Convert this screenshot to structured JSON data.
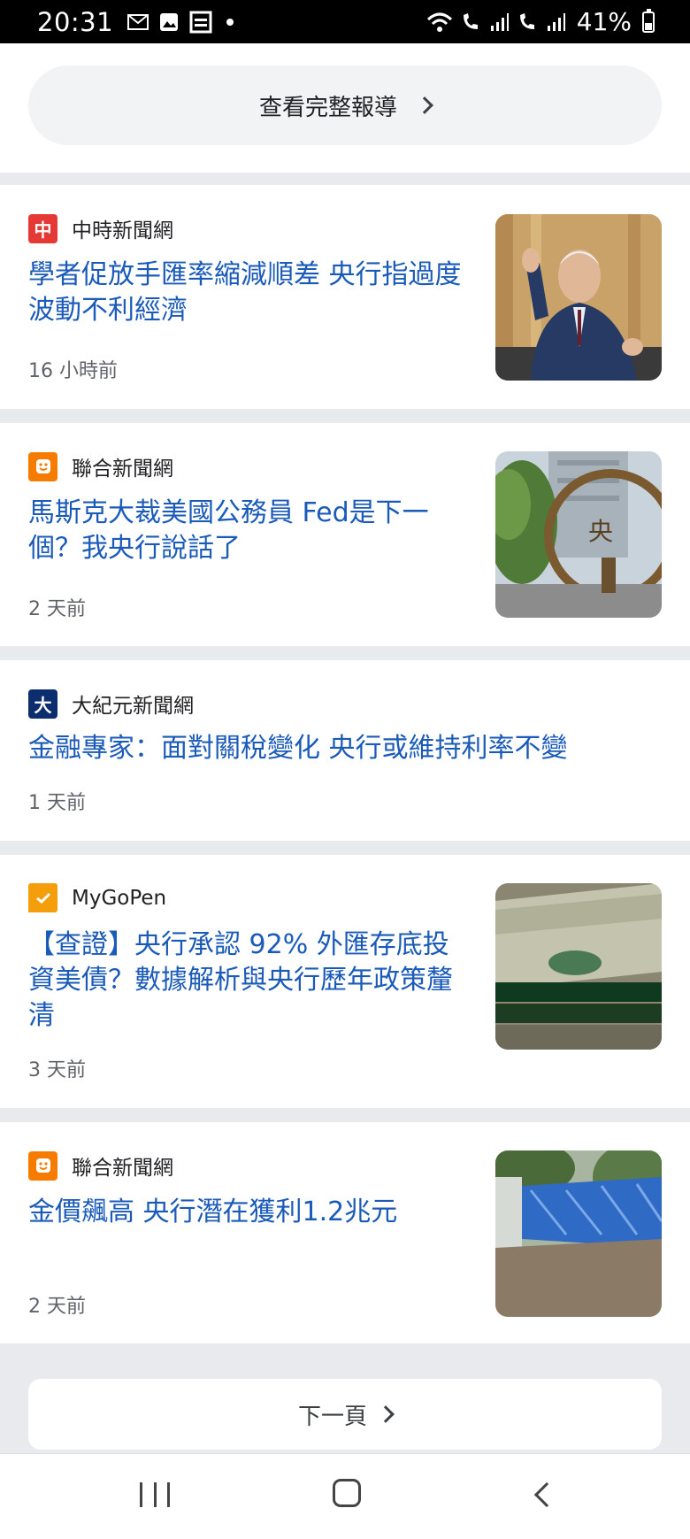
{
  "status_bar": {
    "time": "20:31",
    "battery_percent": "41%",
    "battery_level": 0.41
  },
  "full_coverage": {
    "label": "查看完整報導"
  },
  "articles": [
    {
      "source": "中時新聞網",
      "logo_glyph": "中",
      "logo_color": "#e53935",
      "headline": "學者促放手匯率縮減順差 央行指過度波動不利經濟",
      "time": "16 小時前",
      "thumbnail": "photo-man-speaking"
    },
    {
      "source": "聯合新聞網",
      "logo_glyph": "",
      "logo_color": "#f57c00",
      "headline": "馬斯克大裁美國公務員 Fed是下一個？我央行說話了",
      "time": "2 天前",
      "thumbnail": "photo-central-bank-sign"
    },
    {
      "source": "大紀元新聞網",
      "logo_glyph": "大",
      "logo_color": "#0d2e6e",
      "headline": "金融專家：面對關稅變化 央行或維持利率不變",
      "time": "1 天前",
      "thumbnail": ""
    },
    {
      "source": "MyGoPen",
      "logo_glyph": "",
      "logo_color": "#f59e0b",
      "headline": "【查證】央行承認 92% 外匯存底投資美債？數據解析與央行歷年政策釐清",
      "time": "3 天前",
      "thumbnail": "photo-dollar-bill"
    },
    {
      "source": "聯合新聞網",
      "logo_glyph": "",
      "logo_color": "#f57c00",
      "headline": "金價飆高 央行潛在獲利1.2兆元",
      "time": "2 天前",
      "thumbnail": "photo-gate"
    }
  ],
  "next_page": {
    "label": "下一頁"
  },
  "colors": {
    "headline": "#1a5ab8",
    "divider": "#e8eaed"
  }
}
